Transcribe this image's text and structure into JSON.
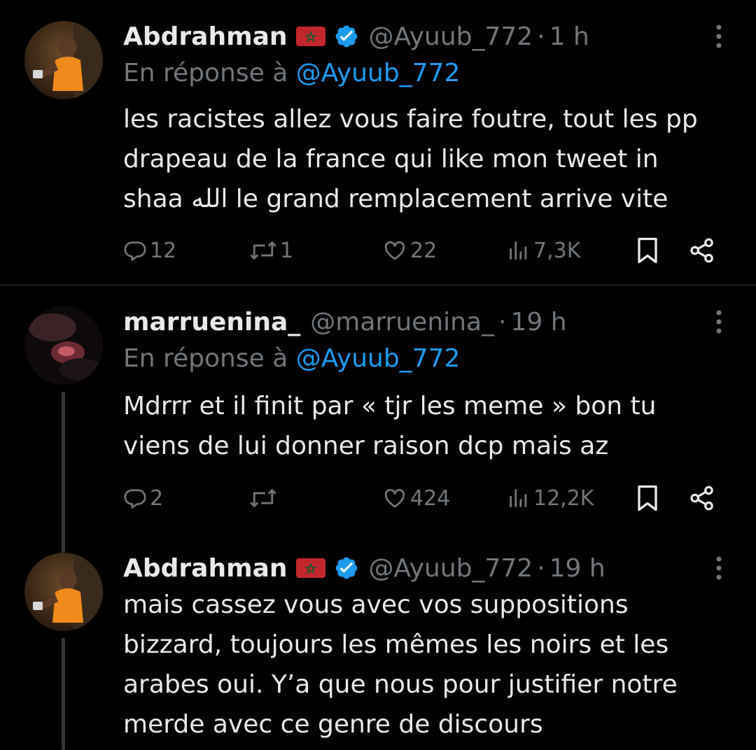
{
  "tweets": [
    {
      "display_name": "Abdrahman",
      "handle": "@Ayuub_772",
      "separator": "·",
      "time": "1 h",
      "reply_prefix": "En réponse à",
      "reply_mention": "@Ayuub_772",
      "text_lines": [
        "les racistes allez vous faire foutre, tout les pp",
        "drapeau de la france qui like mon tweet in",
        "shaa الله le grand remplacement arrive vite"
      ],
      "replies": "12",
      "retweets": "1",
      "likes": "22",
      "views": "7,3K",
      "flag_icon": "morocco-flag",
      "verified_icon": "verified-badge-icon"
    },
    {
      "display_name": "marruenina_",
      "handle": "@marruenina_",
      "separator": "·",
      "time": "19 h",
      "reply_prefix": "En réponse à",
      "reply_mention": "@Ayuub_772",
      "text_lines": [
        "Mdrrr et il finit par « tjr les meme » bon tu",
        "viens de lui donner raison dcp mais az"
      ],
      "replies": "2",
      "retweets": "",
      "likes": "424",
      "views": "12,2K"
    },
    {
      "display_name": "Abdrahman",
      "handle": "@Ayuub_772",
      "separator": "·",
      "time": "19 h",
      "text_lines": [
        "mais cassez vous avec vos suppositions",
        "bizzard, toujours les mêmes les noirs et les",
        "arabes oui. Y’a que nous pour justifier notre",
        "merde avec ce genre de discours"
      ],
      "flag_icon": "morocco-flag",
      "verified_icon": "verified-badge-icon"
    }
  ],
  "colors": {
    "background": "#000000",
    "text": "#e7e9ea",
    "secondary": "#71767b",
    "mention": "#1d9bf0",
    "verified": "#1d9bf0",
    "divider": "#2f3336",
    "thread_line": "#333639"
  }
}
